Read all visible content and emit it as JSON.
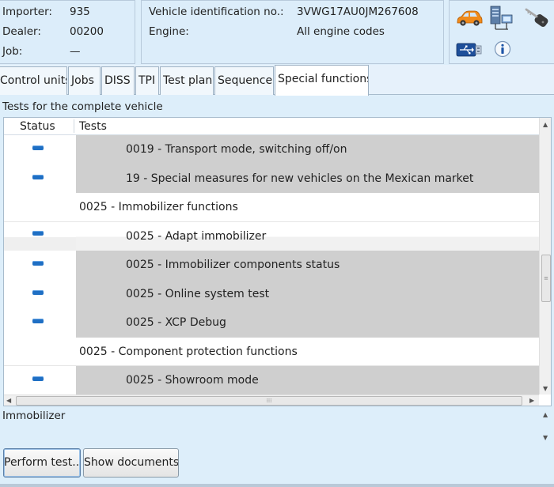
{
  "header": {
    "importer_label": "Importer:",
    "importer_value": "935",
    "dealer_label": "Dealer:",
    "dealer_value": "00200",
    "job_label": "Job:",
    "job_value": "—",
    "vin_label": "Vehicle identification no.:",
    "vin_value": "3VWG17AU0JM267608",
    "engine_label": "Engine:",
    "engine_value": "All engine codes"
  },
  "icons": {
    "car": "car-icon",
    "network": "network-computer-icon",
    "key": "key-icon",
    "usb": "usb-icon",
    "info": "info-icon"
  },
  "tabs": [
    {
      "label": "Control units",
      "active": false
    },
    {
      "label": "Jobs",
      "active": false
    },
    {
      "label": "DISS",
      "active": false
    },
    {
      "label": "TPI",
      "active": false
    },
    {
      "label": "Test plan",
      "active": false
    },
    {
      "label": "Sequence",
      "active": false
    },
    {
      "label": "Special functions",
      "active": true
    }
  ],
  "section_title": "Tests for the complete vehicle",
  "list": {
    "columns": [
      "Status",
      "Tests"
    ],
    "rows": [
      {
        "type": "test",
        "status": true,
        "shaded": true,
        "label": "0019 - Transport mode, switching off/on"
      },
      {
        "type": "test",
        "status": true,
        "shaded": true,
        "label": "19 - Special measures for new vehicles on the Mexican market"
      },
      {
        "type": "group",
        "status": false,
        "shaded": false,
        "label": "0025 - Immobilizer functions"
      },
      {
        "type": "test",
        "status": true,
        "shaded": false,
        "light": true,
        "label": "0025 - Adapt immobilizer"
      },
      {
        "type": "test",
        "status": true,
        "shaded": true,
        "label": "0025 - Immobilizer components status"
      },
      {
        "type": "test",
        "status": true,
        "shaded": true,
        "label": "0025 - Online system test"
      },
      {
        "type": "test",
        "status": true,
        "shaded": true,
        "label": "0025 - XCP Debug"
      },
      {
        "type": "group",
        "status": false,
        "shaded": false,
        "label": "0025 - Component protection functions"
      },
      {
        "type": "test",
        "status": true,
        "shaded": true,
        "label": "0025 - Showroom mode"
      }
    ]
  },
  "detail_text": "Immobilizer",
  "buttons": {
    "perform": "Perform test...",
    "documents": "Show documents"
  },
  "colors": {
    "background": "#ddeefa",
    "shaded_row": "#cfcfcf",
    "status_indicator": "#1f6fc4"
  }
}
